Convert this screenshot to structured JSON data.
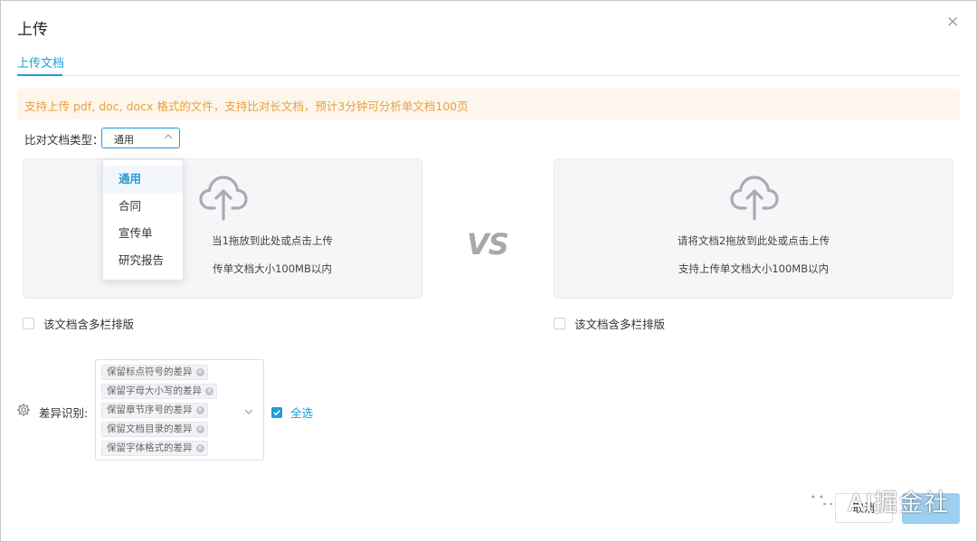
{
  "dialog": {
    "title": "上传",
    "close_label": "×"
  },
  "tabs": [
    {
      "label": "上传文档",
      "active": true
    }
  ],
  "notice": {
    "text": "支持上传 pdf, doc, docx 格式的文件，支持比对长文档，预计3分钟可分析单文档100页",
    "color": "#e6a23c",
    "background": "#fdf6ec"
  },
  "doc_type": {
    "label": "比对文档类型：",
    "selected": "通用",
    "options": [
      "通用",
      "合同",
      "宣传单",
      "研究报告"
    ]
  },
  "upload_left": {
    "icon": "cloud-upload-icon",
    "hint": "请将文档1拖放到此处或点击上传",
    "hint_visible": "当1拖放到此处或点击上传",
    "limit": "支持上传单文档大小100MB以内",
    "limit_visible": "传单文档大小100MB以内",
    "multi_column_label": "该文档含多栏排版"
  },
  "vs_label": "VS",
  "upload_right": {
    "icon": "cloud-upload-icon",
    "hint": "请将文档2拖放到此处或点击上传",
    "limit": "支持上传单文档大小100MB以内",
    "multi_column_label": "该文档含多栏排版"
  },
  "diff": {
    "icon": "gear-icon",
    "label": "差异识别:",
    "tags": [
      "保留标点符号的差异",
      "保留字母大小写的差异",
      "保留章节序号的差异",
      "保留文档目录的差异",
      "保留字体格式的差异"
    ],
    "select_all_label": "全选",
    "select_all_checked": true
  },
  "footer": {
    "cancel_label": "取消",
    "ok_label": "确定"
  },
  "watermark": {
    "icon": "wechat-icon",
    "text": "AI掘金社"
  },
  "colors": {
    "accent": "#1e9ddb",
    "ok_button": "#9ccff0",
    "upload_bg": "#f5f6f8"
  }
}
